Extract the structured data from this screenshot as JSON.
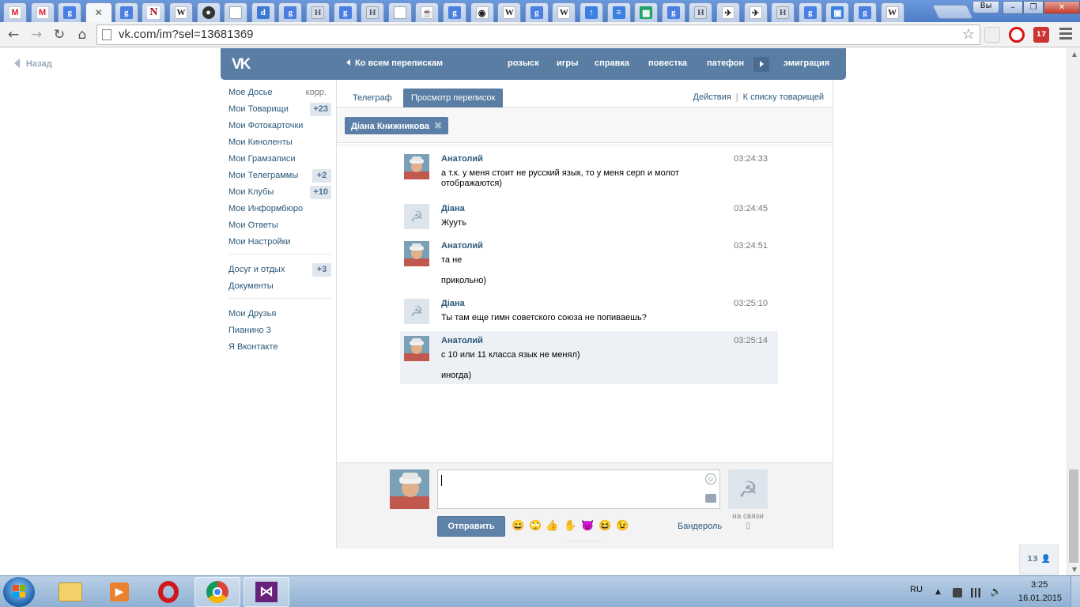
{
  "browser": {
    "tabs": [
      {
        "icon": "gmail-icon",
        "glyph": "M",
        "kind": "m"
      },
      {
        "icon": "gmail-icon",
        "glyph": "M",
        "kind": "m"
      },
      {
        "icon": "google-icon",
        "glyph": "g",
        "kind": "g"
      },
      {
        "icon": "vk-tab-icon",
        "glyph": "",
        "kind": "active"
      },
      {
        "icon": "google-icon",
        "glyph": "g",
        "kind": "g"
      },
      {
        "icon": "netflix-n-icon",
        "glyph": "N",
        "kind": "n"
      },
      {
        "icon": "wikipedia-icon",
        "glyph": "W",
        "kind": "w"
      },
      {
        "icon": "github-icon",
        "glyph": "●",
        "kind": "dark"
      },
      {
        "icon": "document-icon",
        "glyph": "",
        "kind": "doc"
      },
      {
        "icon": "dailymotion-icon",
        "glyph": "d",
        "kind": "d"
      },
      {
        "icon": "google-icon",
        "glyph": "g",
        "kind": "g"
      },
      {
        "icon": "h-site-icon",
        "glyph": "H",
        "kind": "h"
      },
      {
        "icon": "google-icon",
        "glyph": "g",
        "kind": "g"
      },
      {
        "icon": "h-site-icon",
        "glyph": "H",
        "kind": "h"
      },
      {
        "icon": "document-icon",
        "glyph": "",
        "kind": "doc"
      },
      {
        "icon": "teapot-icon",
        "glyph": "☕",
        "kind": "w"
      },
      {
        "icon": "google-icon",
        "glyph": "g",
        "kind": "g"
      },
      {
        "icon": "eye-icon",
        "glyph": "◉",
        "kind": "w"
      },
      {
        "icon": "wikipedia-icon",
        "glyph": "W",
        "kind": "w"
      },
      {
        "icon": "google-icon",
        "glyph": "g",
        "kind": "g"
      },
      {
        "icon": "wikipedia-icon",
        "glyph": "W",
        "kind": "w"
      },
      {
        "icon": "upload-arrow-icon",
        "glyph": "↑",
        "kind": "blue"
      },
      {
        "icon": "docs-icon",
        "glyph": "≡",
        "kind": "blue"
      },
      {
        "icon": "sheets-icon",
        "glyph": "▦",
        "kind": "sheet"
      },
      {
        "icon": "google-icon",
        "glyph": "g",
        "kind": "g"
      },
      {
        "icon": "h-site-icon",
        "glyph": "H",
        "kind": "h"
      },
      {
        "icon": "bird-icon",
        "glyph": "✈",
        "kind": "w"
      },
      {
        "icon": "bird-icon",
        "glyph": "✈",
        "kind": "w"
      },
      {
        "icon": "h-site-icon",
        "glyph": "H",
        "kind": "h"
      },
      {
        "icon": "google-icon",
        "glyph": "g",
        "kind": "g"
      },
      {
        "icon": "contact-card-icon",
        "glyph": "▣",
        "kind": "blue"
      },
      {
        "icon": "google-icon",
        "glyph": "g",
        "kind": "g"
      },
      {
        "icon": "wikipedia-icon",
        "glyph": "W",
        "kind": "w"
      }
    ],
    "user_button": "Вы",
    "url": "vk.com/im?sel=13681369"
  },
  "page": {
    "back_link": "Назад",
    "header": {
      "all_dialogs": "Ко всем перепискам",
      "nav": [
        "розыск",
        "игры",
        "справка",
        "повестка",
        "патефон",
        "эмиграция"
      ]
    },
    "left_menu": {
      "group1": [
        {
          "label": "Мое Досье",
          "extra": "корр.",
          "extra_kind": "corr"
        },
        {
          "label": "Мои Товарищи",
          "extra": "+23",
          "extra_kind": "count"
        },
        {
          "label": "Мои Фотокарточки",
          "extra": "",
          "extra_kind": ""
        },
        {
          "label": "Мои Киноленты",
          "extra": "",
          "extra_kind": ""
        },
        {
          "label": "Мои Грамзаписи",
          "extra": "",
          "extra_kind": ""
        },
        {
          "label": "Мои Телеграммы",
          "extra": "+2",
          "extra_kind": "count"
        },
        {
          "label": "Мои Клубы",
          "extra": "+10",
          "extra_kind": "count"
        },
        {
          "label": "Мое Информбюро",
          "extra": "",
          "extra_kind": ""
        },
        {
          "label": "Мои Ответы",
          "extra": "",
          "extra_kind": ""
        },
        {
          "label": "Мои Настройки",
          "extra": "",
          "extra_kind": ""
        }
      ],
      "group2": [
        {
          "label": "Досуг и отдых",
          "extra": "+3",
          "extra_kind": "count"
        },
        {
          "label": "Документы",
          "extra": "",
          "extra_kind": ""
        }
      ],
      "group3": [
        {
          "label": "Мои Друзья",
          "extra": "",
          "extra_kind": ""
        },
        {
          "label": "Пианино 3",
          "extra": "",
          "extra_kind": ""
        },
        {
          "label": "Я Вконтакте",
          "extra": "",
          "extra_kind": ""
        }
      ]
    },
    "tabs": {
      "telegraph": "Телеграф",
      "view": "Просмотр переписок",
      "actions": "Действия",
      "to_friends": "К списку товарищей"
    },
    "peer_chip": "Діана Книжникова",
    "messages": [
      {
        "author": "Анатолий",
        "time": "03:24:33",
        "lines": [
          "а т.к. у меня стоит не русский язык, то у меня серп и молот",
          "отображаются)"
        ],
        "avatar": "photo",
        "highlight": false
      },
      {
        "author": "Діана",
        "time": "03:24:45",
        "lines": [
          "Жууть"
        ],
        "avatar": "sickle",
        "highlight": false
      },
      {
        "author": "Анатолий",
        "time": "03:24:51",
        "lines": [
          "та не",
          "",
          "прикольно)"
        ],
        "avatar": "photo",
        "highlight": false
      },
      {
        "author": "Діана",
        "time": "03:25:10",
        "lines": [
          "Ты там еще гимн советского союза не попиваешь?"
        ],
        "avatar": "sickle",
        "highlight": false
      },
      {
        "author": "Анатолий",
        "time": "03:25:14",
        "lines": [
          "с 10 или 11 класса язык не менял)",
          "",
          "иногда)"
        ],
        "avatar": "photo",
        "highlight": true
      }
    ],
    "composer": {
      "send": "Отправить",
      "banderol": "Бандероль",
      "online": "на связи",
      "emojis": [
        "😄",
        "🙄",
        "👍",
        "✋",
        "😈",
        "😆",
        "😉"
      ]
    },
    "friends_counter": "13"
  },
  "taskbar": {
    "lang": "RU",
    "time": "3:25",
    "date": "16.01.2015"
  },
  "colors": {
    "vk_blue": "#597da3",
    "link": "#2b587a",
    "taskbar": "#9fbbdc"
  }
}
